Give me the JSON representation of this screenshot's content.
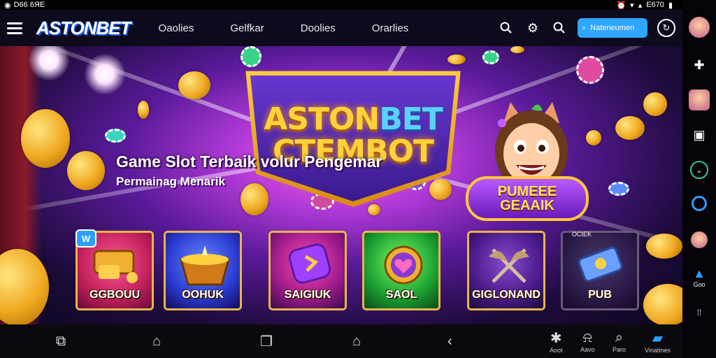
{
  "status_bar": {
    "left_text": "D66 6ЯE",
    "right_text": "E670"
  },
  "topnav": {
    "logo": "ASTONBET",
    "links": [
      "Oaolies",
      "Gelfkar",
      "Doolies",
      "Orarlies"
    ],
    "search_placeholder": "Naterieumen"
  },
  "hero": {
    "title_line1_a": "ASTON",
    "title_line1_b": "BET",
    "title_line2": "CTEMBO",
    "title_line2_end": "T",
    "headline": "Game Slot Terbaik volur Pengemar",
    "subheadline": "Permainag Menarik",
    "badge_line1": "PUMEEE",
    "badge_line2": "GEAAIK",
    "card_tag": "W",
    "card_mini_tag": "OCIEK",
    "cards": [
      {
        "label": "GGBOUU"
      },
      {
        "label": "OOHUK"
      },
      {
        "label": "SAIGIUK"
      },
      {
        "label": "SAOL"
      },
      {
        "label": "GIGLONAND"
      },
      {
        "label": "PUB"
      }
    ]
  },
  "bottom_bar": {
    "labels": [
      "Aoot",
      "Aavo",
      "Paro",
      "Vinatines"
    ]
  },
  "side_rail": {
    "bottom_label": "Goo"
  }
}
